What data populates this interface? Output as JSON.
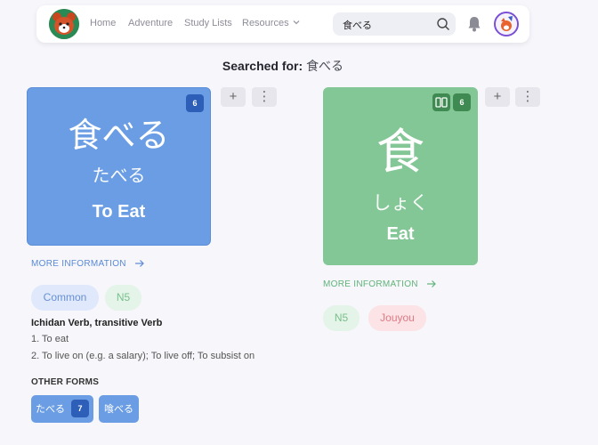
{
  "nav": {
    "links": [
      "Home",
      "Adventure",
      "Study Lists",
      "Resources"
    ],
    "search_value": "食べる"
  },
  "heading": {
    "label": "Searched for:",
    "term": "食べる"
  },
  "word_card": {
    "word": "食べる",
    "reading": "たべる",
    "meaning": "To Eat",
    "count": "6",
    "color": "#6a9de3"
  },
  "kanji_card": {
    "kanji": "食",
    "reading": "しょく",
    "meaning": "Eat",
    "count": "6",
    "color": "#84c796"
  },
  "actions": {
    "add": "+",
    "more": "⋮"
  },
  "more_info_label": "MORE INFORMATION",
  "word_tags": [
    "Common",
    "N5"
  ],
  "kanji_tags": [
    "N5",
    "Jouyou"
  ],
  "definition": {
    "part_of_speech": "Ichidan Verb, transitive Verb",
    "senses": [
      "1. To eat",
      "2. To live on (e.g. a salary); To live off; To subsist on"
    ]
  },
  "other_forms": {
    "label": "OTHER FORMS",
    "forms": [
      {
        "text": "たべる",
        "count": "7"
      },
      {
        "text": "喰べる"
      }
    ]
  }
}
